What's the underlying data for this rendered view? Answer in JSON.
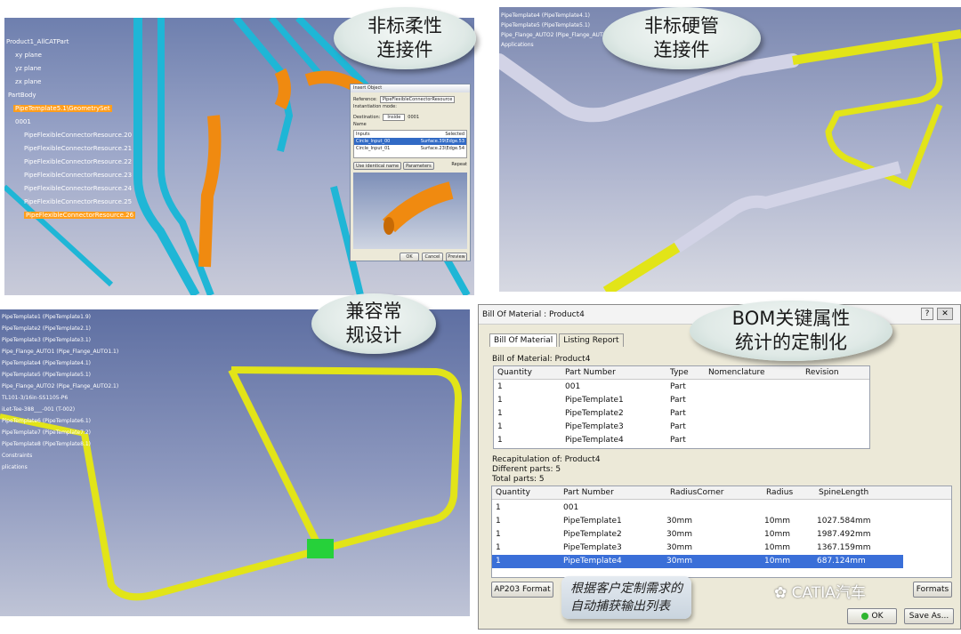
{
  "callouts": {
    "tl": [
      "非标柔性",
      "连接件"
    ],
    "tr": [
      "非标硬管",
      "连接件"
    ],
    "bl": [
      "兼容常",
      "规设计"
    ],
    "br": [
      "BOM关键属性",
      "统计的定制化"
    ],
    "note": [
      "根据客户定制需求的",
      "自动捕获输出列表"
    ]
  },
  "tl_tree": [
    "Product1_AllCATPart",
    "xy plane",
    "yz plane",
    "zx plane",
    "PartBody",
    "PipeTemplate5.1\\GeometrySet",
    "0001",
    "PipeFlexibleConnectorResource.20",
    "PipeFlexibleConnectorResource.21",
    "PipeFlexibleConnectorResource.22",
    "PipeFlexibleConnectorResource.23",
    "PipeFlexibleConnectorResource.24",
    "PipeFlexibleConnectorResource.25",
    "PipeFlexibleConnectorResource.26"
  ],
  "insert_dialog": {
    "title": "Insert Object",
    "reference_label": "Reference:",
    "reference_value": "PipeFlexibleConnectorResource",
    "inst_label": "Instantiation mode:",
    "dest_label": "Destination:",
    "dest_value": "Inside",
    "dest_num": "0001",
    "name_label": "Name",
    "inputs_h": "Inputs",
    "selected_h": "Selected",
    "in1": "Circle_Input_00",
    "sel1": "Surface.39\\Edge.53",
    "in2": "Circle_Input_01",
    "sel2": "Surface.23\\Edge.54",
    "use_id": "Use identical name",
    "params": "Parameters",
    "repeat": "Repeat",
    "ok": "OK",
    "cancel": "Cancel",
    "preview": "Preview"
  },
  "tr_tree": [
    "PipeTemplate4 (PipeTemplate4.1)",
    "PipeTemplate5 (PipeTemplate5.1)",
    "Pipe_Flange_AUTO2 (Pipe_Flange_AUTO2",
    "Applications"
  ],
  "bl_tree": [
    "PipeTemplate1 (PipeTemplate1.9)",
    "PipeTemplate2 (PipeTemplate2.1)",
    "PipeTemplate3 (PipeTemplate3.1)",
    "Pipe_Flange_AUTO1 (Pipe_Flange_AUTO1.1)",
    "PipeTemplate4 (PipeTemplate4.1)",
    "PipeTemplate5 (PipeTemplate5.1)",
    "Pipe_Flange_AUTO2 (Pipe_Flange_AUTO2.1)",
    "TL101-3/16in-SS1105-P6",
    "iLet-Tee-388___-001 (T-002)",
    "PipeTemplate6 (PipeTemplate6.1)",
    "PipeTemplate7 (PipeTemplate7.2)",
    "PipeTemplate8 (PipeTemplate8.1)",
    "Constraints",
    "plications"
  ],
  "bom": {
    "window_title": "Bill Of Material : Product4",
    "tab1": "Bill Of Material",
    "tab2": "Listing Report",
    "section1": "Bill of Material: Product4",
    "cols1": [
      "Quantity",
      "Part Number",
      "Type",
      "Nomenclature",
      "Revision"
    ],
    "rows1": [
      [
        "1",
        "001",
        "Part",
        "",
        ""
      ],
      [
        "1",
        "PipeTemplate1",
        "Part",
        "",
        ""
      ],
      [
        "1",
        "PipeTemplate2",
        "Part",
        "",
        ""
      ],
      [
        "1",
        "PipeTemplate3",
        "Part",
        "",
        ""
      ],
      [
        "1",
        "PipeTemplate4",
        "Part",
        "",
        ""
      ]
    ],
    "recap": "Recapitulation of: Product4",
    "diff": "Different parts: 5",
    "total": "Total parts: 5",
    "cols2": [
      "Quantity",
      "Part Number",
      "RadiusCorner",
      "Radius",
      "SpineLength"
    ],
    "rows2": [
      [
        "1",
        "001",
        "",
        "",
        ""
      ],
      [
        "1",
        "PipeTemplate1",
        "30mm",
        "10mm",
        "1027.584mm"
      ],
      [
        "1",
        "PipeTemplate2",
        "30mm",
        "10mm",
        "1987.492mm"
      ],
      [
        "1",
        "PipeTemplate3",
        "30mm",
        "10mm",
        "1367.159mm"
      ],
      [
        "1",
        "PipeTemplate4",
        "30mm",
        "10mm",
        "687.124mm"
      ]
    ],
    "ap203": "AP203 Format",
    "formats": "Formats",
    "ok": "OK",
    "saveas": "Save As..."
  },
  "watermark": "CATIA汽车",
  "colors": {
    "cyan_pipe": "#1fb6d6",
    "orange_pipe": "#f08a10",
    "yellow_pipe": "#e2e418",
    "selected_row": "#3a6fd8"
  }
}
